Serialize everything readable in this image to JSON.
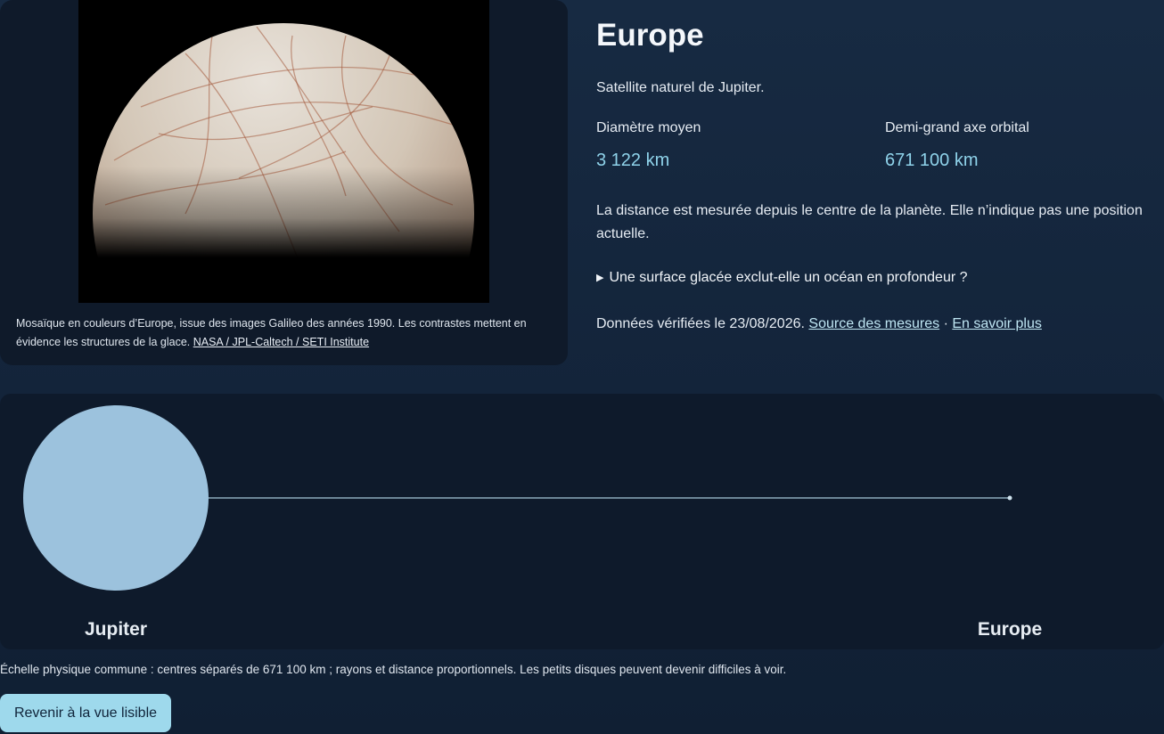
{
  "figure": {
    "caption_text": "Mosaïque en couleurs d’Europe, issue des images Galileo des années 1990. Les contrastes mettent en évidence les structures de la glace.",
    "credit_link": "NASA / JPL-Caltech / SETI Institute"
  },
  "info": {
    "title": "Europe",
    "subtitle": "Satellite naturel de Jupiter.",
    "stats": [
      {
        "label": "Diamètre moyen",
        "value": "3 122 km"
      },
      {
        "label": "Demi-grand axe orbital",
        "value": "671 100 km"
      }
    ],
    "note": "La distance est mesurée depuis le centre de la planète. Elle n’indique pas une position actuelle.",
    "disclosure": "Une surface glacée exclut-elle un océan en profondeur ?",
    "verified_text": "Données vérifiées le 23/08/2026.",
    "source_link": "Source des mesures",
    "separator": "·",
    "more_link": "En savoir plus"
  },
  "scale": {
    "planet_label": "Jupiter",
    "moon_label": "Europe",
    "caption": "Échelle physique commune : centres séparés de 671 100 km ; rayons et distance proportionnels. Les petits disques peuvent devenir difficiles à voir."
  },
  "actions": {
    "back_label": "Revenir à la vue lisible"
  },
  "colors": {
    "accent": "#8fd3ea",
    "button_bg": "#9ed9ec",
    "planet_fill": "#9cc2dd"
  }
}
